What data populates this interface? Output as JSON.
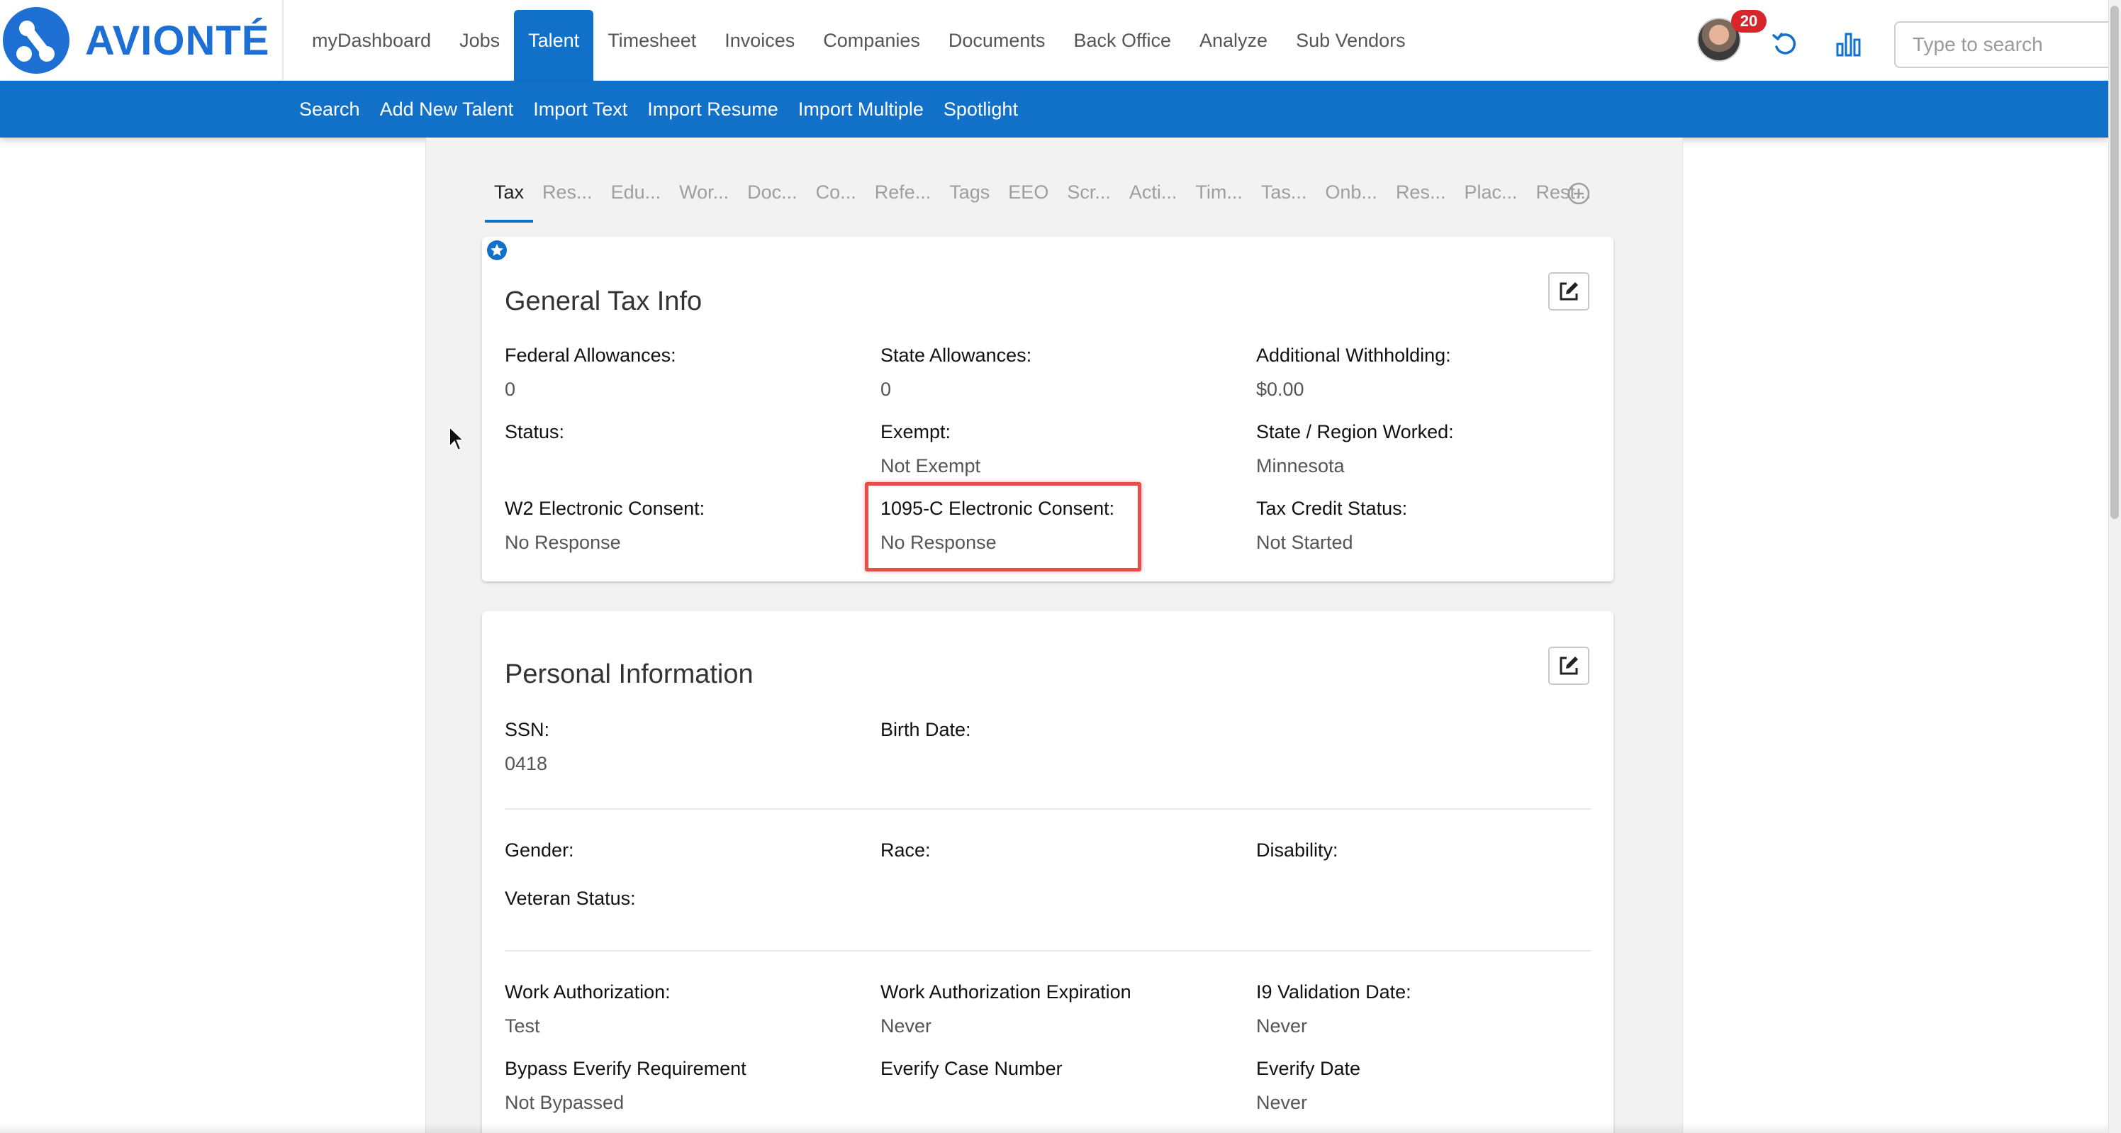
{
  "app": {
    "logo_text": "AVIONTÉ",
    "brand_color": "#1170c8",
    "highlight_color": "#e84d4a"
  },
  "main_nav": [
    {
      "label": "myDashboard"
    },
    {
      "label": "Jobs"
    },
    {
      "label": "Talent",
      "active": true
    },
    {
      "label": "Timesheet"
    },
    {
      "label": "Invoices"
    },
    {
      "label": "Companies"
    },
    {
      "label": "Documents"
    },
    {
      "label": "Back Office"
    },
    {
      "label": "Analyze"
    },
    {
      "label": "Sub Vendors"
    }
  ],
  "header": {
    "notification_count": "20",
    "search_placeholder": "Type to search",
    "icons": [
      "avatar",
      "refresh-icon",
      "bar-chart-icon"
    ]
  },
  "sub_nav": [
    {
      "label": "Search"
    },
    {
      "label": "Add New Talent"
    },
    {
      "label": "Import Text"
    },
    {
      "label": "Import Resume"
    },
    {
      "label": "Import Multiple"
    },
    {
      "label": "Spotlight"
    }
  ],
  "tabs": [
    {
      "label": "Tax",
      "active": true
    },
    {
      "label": "Res..."
    },
    {
      "label": "Edu..."
    },
    {
      "label": "Wor..."
    },
    {
      "label": "Doc..."
    },
    {
      "label": "Co..."
    },
    {
      "label": "Refe..."
    },
    {
      "label": "Tags"
    },
    {
      "label": "EEO"
    },
    {
      "label": "Scr..."
    },
    {
      "label": "Acti..."
    },
    {
      "label": "Tim..."
    },
    {
      "label": "Tas..."
    },
    {
      "label": "Onb..."
    },
    {
      "label": "Res..."
    },
    {
      "label": "Plac..."
    },
    {
      "label": "Rest..."
    }
  ],
  "general_tax": {
    "title": "General Tax Info",
    "federal_allowances": {
      "label": "Federal Allowances:",
      "value": "0"
    },
    "state_allowances": {
      "label": "State Allowances:",
      "value": "0"
    },
    "additional_withholding": {
      "label": "Additional Withholding:",
      "value": "$0.00"
    },
    "status": {
      "label": "Status:",
      "value": ""
    },
    "exempt": {
      "label": "Exempt:",
      "value": "Not Exempt"
    },
    "state_region": {
      "label": "State / Region Worked:",
      "value": "Minnesota"
    },
    "w2_consent": {
      "label": "W2 Electronic Consent:",
      "value": "No Response"
    },
    "c1095_consent": {
      "label": "1095-C Electronic Consent:",
      "value": "No Response"
    },
    "tax_credit": {
      "label": "Tax Credit Status:",
      "value": "Not Started"
    }
  },
  "personal": {
    "title": "Personal Information",
    "ssn": {
      "label": "SSN:",
      "value": "0418"
    },
    "birth_date": {
      "label": "Birth Date:",
      "value": ""
    },
    "gender": {
      "label": "Gender:",
      "value": ""
    },
    "race": {
      "label": "Race:",
      "value": ""
    },
    "disability": {
      "label": "Disability:",
      "value": ""
    },
    "veteran": {
      "label": "Veteran Status:",
      "value": ""
    },
    "work_auth": {
      "label": "Work Authorization:",
      "value": "Test"
    },
    "work_auth_exp": {
      "label": "Work Authorization Expiration",
      "value": "Never"
    },
    "i9_date": {
      "label": "I9 Validation Date:",
      "value": "Never"
    },
    "bypass_everify": {
      "label": "Bypass Everify Requirement",
      "value": "Not Bypassed"
    },
    "everify_case": {
      "label": "Everify Case Number",
      "value": ""
    },
    "everify_date": {
      "label": "Everify Date",
      "value": "Never"
    }
  }
}
